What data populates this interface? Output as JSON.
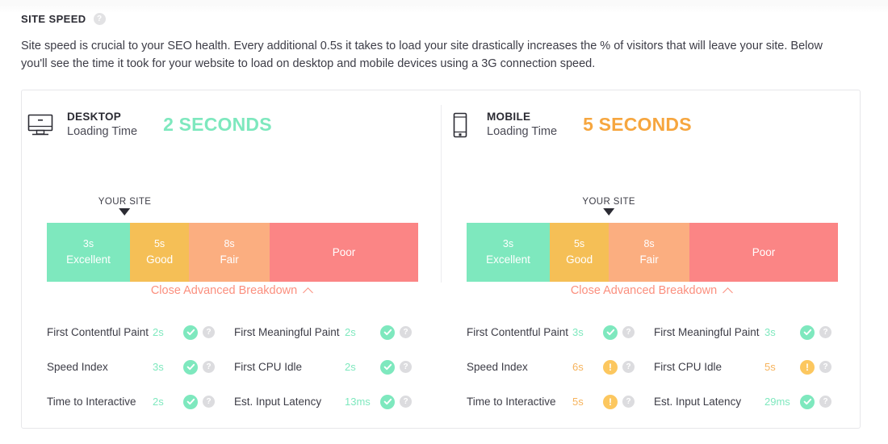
{
  "header": {
    "title": "SITE SPEED",
    "help_icon": "?",
    "intro": "Site speed is crucial to your SEO health. Every additional 0.5s it takes to load your site drastically increases the % of visitors that will leave your site. Below you'll see the time it took for your website to load on desktop and mobile devices using a 3G connection speed."
  },
  "colors": {
    "excellent": "#7ee8be",
    "good": "#f5bf56",
    "fair": "#fbae80",
    "poor": "#fb8585",
    "link": "#fb8f7e",
    "warn": "#fcc75f"
  },
  "panels": [
    {
      "id": "desktop",
      "device_icon": "desktop-monitor-icon",
      "device_type": "DESKTOP",
      "device_sub": "Loading Time",
      "loading_time": "2 SECONDS",
      "loading_time_color": "#7ee8be",
      "pointer_label": "YOUR SITE",
      "pointer_pct": 21,
      "gauge": [
        {
          "top": "3s",
          "bottom": "Excellent",
          "color": "#7ee8be",
          "width_pct": 22.4
        },
        {
          "top": "5s",
          "bottom": "Good",
          "color": "#f5bf56",
          "width_pct": 15.9
        },
        {
          "top": "8s",
          "bottom": "Fair",
          "color": "#fbae80",
          "width_pct": 21.7
        },
        {
          "top": "",
          "bottom": "Poor",
          "color": "#fb8585",
          "width_pct": 40.0
        }
      ],
      "toggle_label": "Close Advanced Breakdown",
      "toggle_icon": "chevron-up-icon",
      "metrics_left": [
        {
          "name": "First Contentful Paint",
          "value": "2s",
          "status": "ok"
        },
        {
          "name": "Speed Index",
          "value": "3s",
          "status": "ok"
        },
        {
          "name": "Time to Interactive",
          "value": "2s",
          "status": "ok"
        }
      ],
      "metrics_right": [
        {
          "name": "First Meaningful Paint",
          "value": "2s",
          "status": "ok"
        },
        {
          "name": "First CPU Idle",
          "value": "2s",
          "status": "ok"
        },
        {
          "name": "Est. Input Latency",
          "value": "13ms",
          "status": "ok"
        }
      ]
    },
    {
      "id": "mobile",
      "device_icon": "mobile-phone-icon",
      "device_type": "MOBILE",
      "device_sub": "Loading Time",
      "loading_time": "5 SECONDS",
      "loading_time_color": "#f6a63f",
      "pointer_label": "YOUR SITE",
      "pointer_pct": 38.3,
      "gauge": [
        {
          "top": "3s",
          "bottom": "Excellent",
          "color": "#7ee8be",
          "width_pct": 22.4
        },
        {
          "top": "5s",
          "bottom": "Good",
          "color": "#f5bf56",
          "width_pct": 15.9
        },
        {
          "top": "8s",
          "bottom": "Fair",
          "color": "#fbae80",
          "width_pct": 21.7
        },
        {
          "top": "",
          "bottom": "Poor",
          "color": "#fb8585",
          "width_pct": 40.0
        }
      ],
      "toggle_label": "Close Advanced Breakdown",
      "toggle_icon": "chevron-up-icon",
      "metrics_left": [
        {
          "name": "First Contentful Paint",
          "value": "3s",
          "status": "ok"
        },
        {
          "name": "Speed Index",
          "value": "6s",
          "status": "warn"
        },
        {
          "name": "Time to Interactive",
          "value": "5s",
          "status": "warn"
        }
      ],
      "metrics_right": [
        {
          "name": "First Meaningful Paint",
          "value": "3s",
          "status": "ok"
        },
        {
          "name": "First CPU Idle",
          "value": "5s",
          "status": "warn"
        },
        {
          "name": "Est. Input Latency",
          "value": "29ms",
          "status": "ok"
        }
      ]
    }
  ],
  "metric_help_icon": "?"
}
